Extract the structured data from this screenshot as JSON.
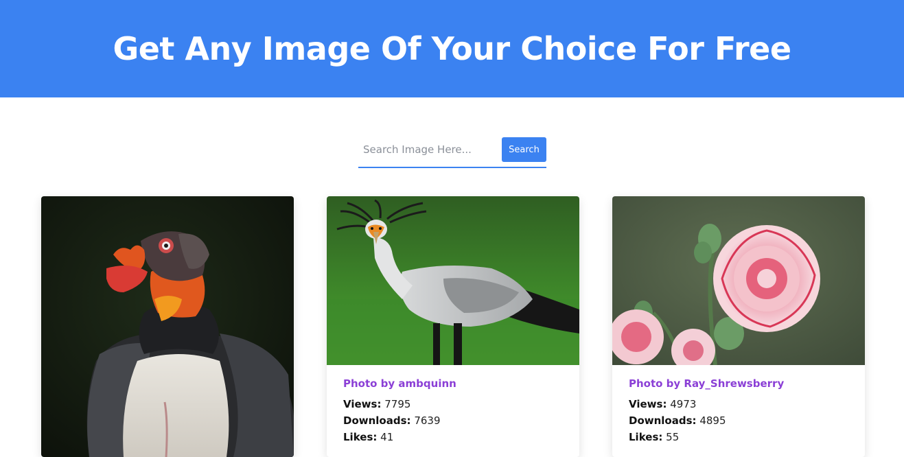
{
  "header": {
    "title": "Get Any Image Of Your Choice For Free"
  },
  "search": {
    "placeholder": "Search Image Here...",
    "value": "",
    "button_label": "Search"
  },
  "cards": [
    {
      "image": "king-vulture-photo",
      "author": "",
      "views": "",
      "downloads": "",
      "likes": ""
    },
    {
      "image": "secretary-bird-photo",
      "author": "Photo by ambquinn",
      "views_label": "Views:",
      "views": "7795",
      "downloads_label": "Downloads:",
      "downloads": "7639",
      "likes_label": "Likes:",
      "likes": "41"
    },
    {
      "image": "carnation-flower-photo",
      "author": "Photo by Ray_Shrewsberry",
      "views_label": "Views:",
      "views": "4973",
      "downloads_label": "Downloads:",
      "downloads": "4895",
      "likes_label": "Likes:",
      "likes": "55"
    }
  ],
  "colors": {
    "primary": "#3b82f1",
    "author": "#8b3fd6"
  }
}
